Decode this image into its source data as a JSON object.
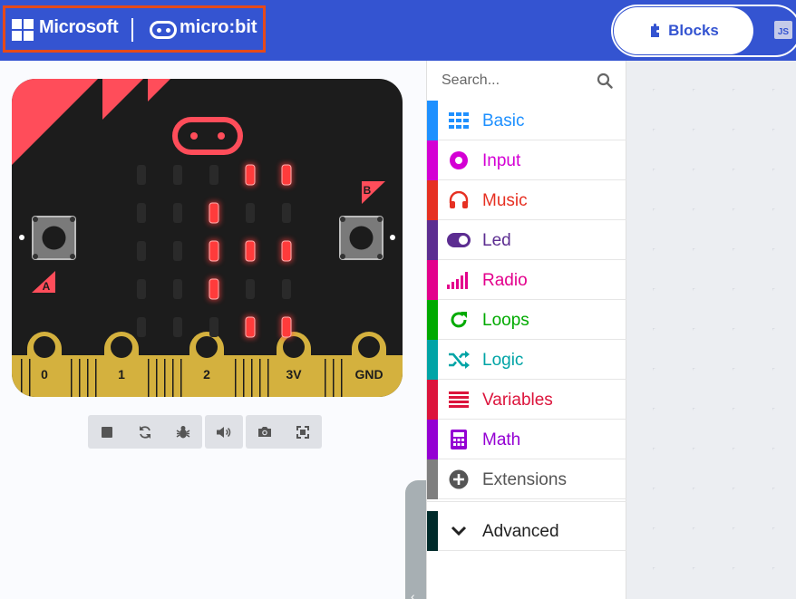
{
  "header": {
    "brand_microsoft": "Microsoft",
    "brand_microbit": "micro:bit",
    "tab_blocks": "Blocks",
    "tab_js": "JS"
  },
  "simulator": {
    "pins": [
      "0",
      "1",
      "2",
      "3V",
      "GND"
    ],
    "button_a": "A",
    "button_b": "B",
    "led_matrix": [
      [
        0,
        0,
        0,
        1,
        1
      ],
      [
        0,
        0,
        1,
        0,
        0
      ],
      [
        0,
        0,
        1,
        1,
        1
      ],
      [
        0,
        0,
        1,
        0,
        0
      ],
      [
        0,
        0,
        0,
        1,
        1
      ]
    ],
    "toolbar_icons": [
      "stop-icon",
      "restart-icon",
      "debug-icon",
      "mute-icon",
      "screenshot-icon",
      "fullscreen-icon"
    ]
  },
  "toolbox": {
    "search_placeholder": "Search...",
    "categories": [
      {
        "label": "Basic",
        "color": "#1e90ff",
        "icon": "grid-icon"
      },
      {
        "label": "Input",
        "color": "#d400d4",
        "icon": "radio-circle-icon"
      },
      {
        "label": "Music",
        "color": "#e63022",
        "icon": "headphones-icon"
      },
      {
        "label": "Led",
        "color": "#5c2d91",
        "icon": "toggle-icon"
      },
      {
        "label": "Radio",
        "color": "#e3008c",
        "icon": "signal-bars-icon"
      },
      {
        "label": "Loops",
        "color": "#00aa00",
        "icon": "refresh-icon"
      },
      {
        "label": "Logic",
        "color": "#00a4a6",
        "icon": "shuffle-icon"
      },
      {
        "label": "Variables",
        "color": "#dc143c",
        "icon": "lines-icon"
      },
      {
        "label": "Math",
        "color": "#9400d3",
        "icon": "calculator-icon"
      },
      {
        "label": "Extensions",
        "color": "#7f7f7f",
        "icon": "plus-circle-icon"
      }
    ],
    "advanced_label": "Advanced",
    "advanced_color": "#002b2b"
  },
  "colors": {
    "header_bg": "#3454d1",
    "board_bg": "#1c1c1c",
    "led_on": "#ff3b3b",
    "pin_gold": "#d4b13e"
  }
}
